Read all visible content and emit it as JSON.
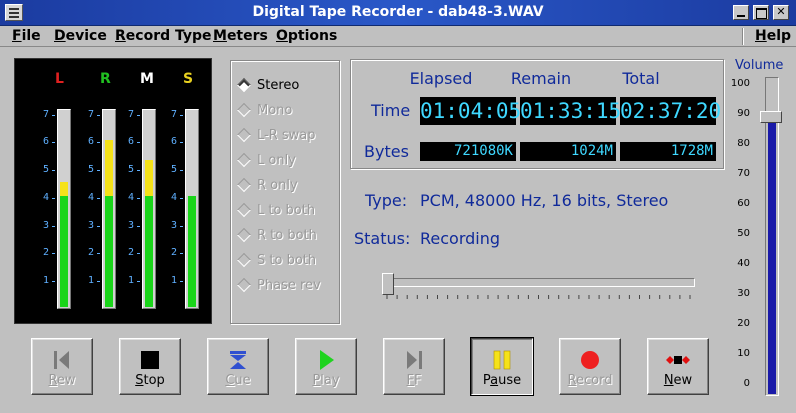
{
  "window": {
    "title": "Digital Tape Recorder - dab48-3.WAV"
  },
  "menu": [
    {
      "label": "File",
      "u": "F",
      "rest": "ile"
    },
    {
      "label": "Device",
      "u": "D",
      "rest": "evice"
    },
    {
      "label": "Record Type",
      "u": "R",
      "rest": "ecord Type"
    },
    {
      "label": "Meters",
      "u": "M",
      "rest": "eters"
    },
    {
      "label": "Options",
      "u": "O",
      "rest": "ptions"
    },
    {
      "label": "Help",
      "u": "H",
      "rest": "elp"
    }
  ],
  "meters": {
    "channels": [
      {
        "label": "L",
        "color": "#e02020",
        "green": 4.0,
        "yellow": 0.5
      },
      {
        "label": "R",
        "color": "#20c020",
        "green": 4.0,
        "yellow": 2.0
      },
      {
        "label": "M",
        "color": "#ffffff",
        "green": 4.0,
        "yellow": 1.3
      },
      {
        "label": "S",
        "color": "#e8d020",
        "green": 4.0,
        "yellow": 0
      }
    ],
    "scale": [
      "7",
      "6",
      "5",
      "4",
      "3",
      "2",
      "1"
    ]
  },
  "modes": [
    {
      "label": "Stereo",
      "active": true
    },
    {
      "label": "Mono",
      "active": false
    },
    {
      "label": "L-R swap",
      "active": false
    },
    {
      "label": "L only",
      "active": false
    },
    {
      "label": "R only",
      "active": false
    },
    {
      "label": "L to both",
      "active": false
    },
    {
      "label": "R to both",
      "active": false
    },
    {
      "label": "S to both",
      "active": false
    },
    {
      "label": "Phase rev",
      "active": false
    }
  ],
  "info": {
    "headers": {
      "elapsed": "Elapsed",
      "remain": "Remain",
      "total": "Total"
    },
    "time_label": "Time",
    "bytes_label": "Bytes",
    "time": {
      "elapsed": "01:04:05",
      "remain": "01:33:15",
      "total": "02:37:20"
    },
    "bytes": {
      "elapsed": "721080K",
      "remain": "1024M",
      "total": "1728M"
    }
  },
  "details": {
    "type_label": "Type:",
    "type_value": "PCM, 48000 Hz, 16 bits, Stereo",
    "status_label": "Status:",
    "status_value": "Recording"
  },
  "position_fraction": 0.0,
  "transport": [
    {
      "id": "rew",
      "label": "Rew",
      "u": "R",
      "rest": "ew",
      "icon": "rewind-icon",
      "disabled": true
    },
    {
      "id": "stop",
      "label": "Stop",
      "u": "S",
      "rest": "top",
      "icon": "stop-icon",
      "disabled": false
    },
    {
      "id": "cue",
      "label": "Cue",
      "u": "C",
      "rest": "ue",
      "icon": "cue-icon",
      "disabled": true
    },
    {
      "id": "play",
      "label": "Play",
      "u": "P",
      "rest": "lay",
      "icon": "play-icon",
      "disabled": true
    },
    {
      "id": "ff",
      "label": "FF",
      "u": "F",
      "rest": "F",
      "icon": "fast-forward-icon",
      "disabled": true
    },
    {
      "id": "pause",
      "label": "Pause",
      "u": "a",
      "pre": "P",
      "rest": "use",
      "icon": "pause-icon",
      "disabled": false,
      "pressed": true
    },
    {
      "id": "record",
      "label": "Record",
      "u": "R",
      "rest": "ecord",
      "icon": "record-icon",
      "disabled": true
    },
    {
      "id": "new",
      "label": "New",
      "u": "N",
      "rest": "ew",
      "icon": "new-icon",
      "disabled": false
    }
  ],
  "volume": {
    "label": "Volume",
    "scale": [
      "100",
      "90",
      "80",
      "70",
      "60",
      "50",
      "40",
      "30",
      "20",
      "10",
      "0"
    ],
    "value": 89
  },
  "colors": {
    "lcd_text": "#3fd8ff",
    "label_blue": "#102a9a",
    "meter_green": "#1ad51a",
    "meter_yellow": "#f5e21a",
    "volume_fill": "#1a1aa8"
  }
}
